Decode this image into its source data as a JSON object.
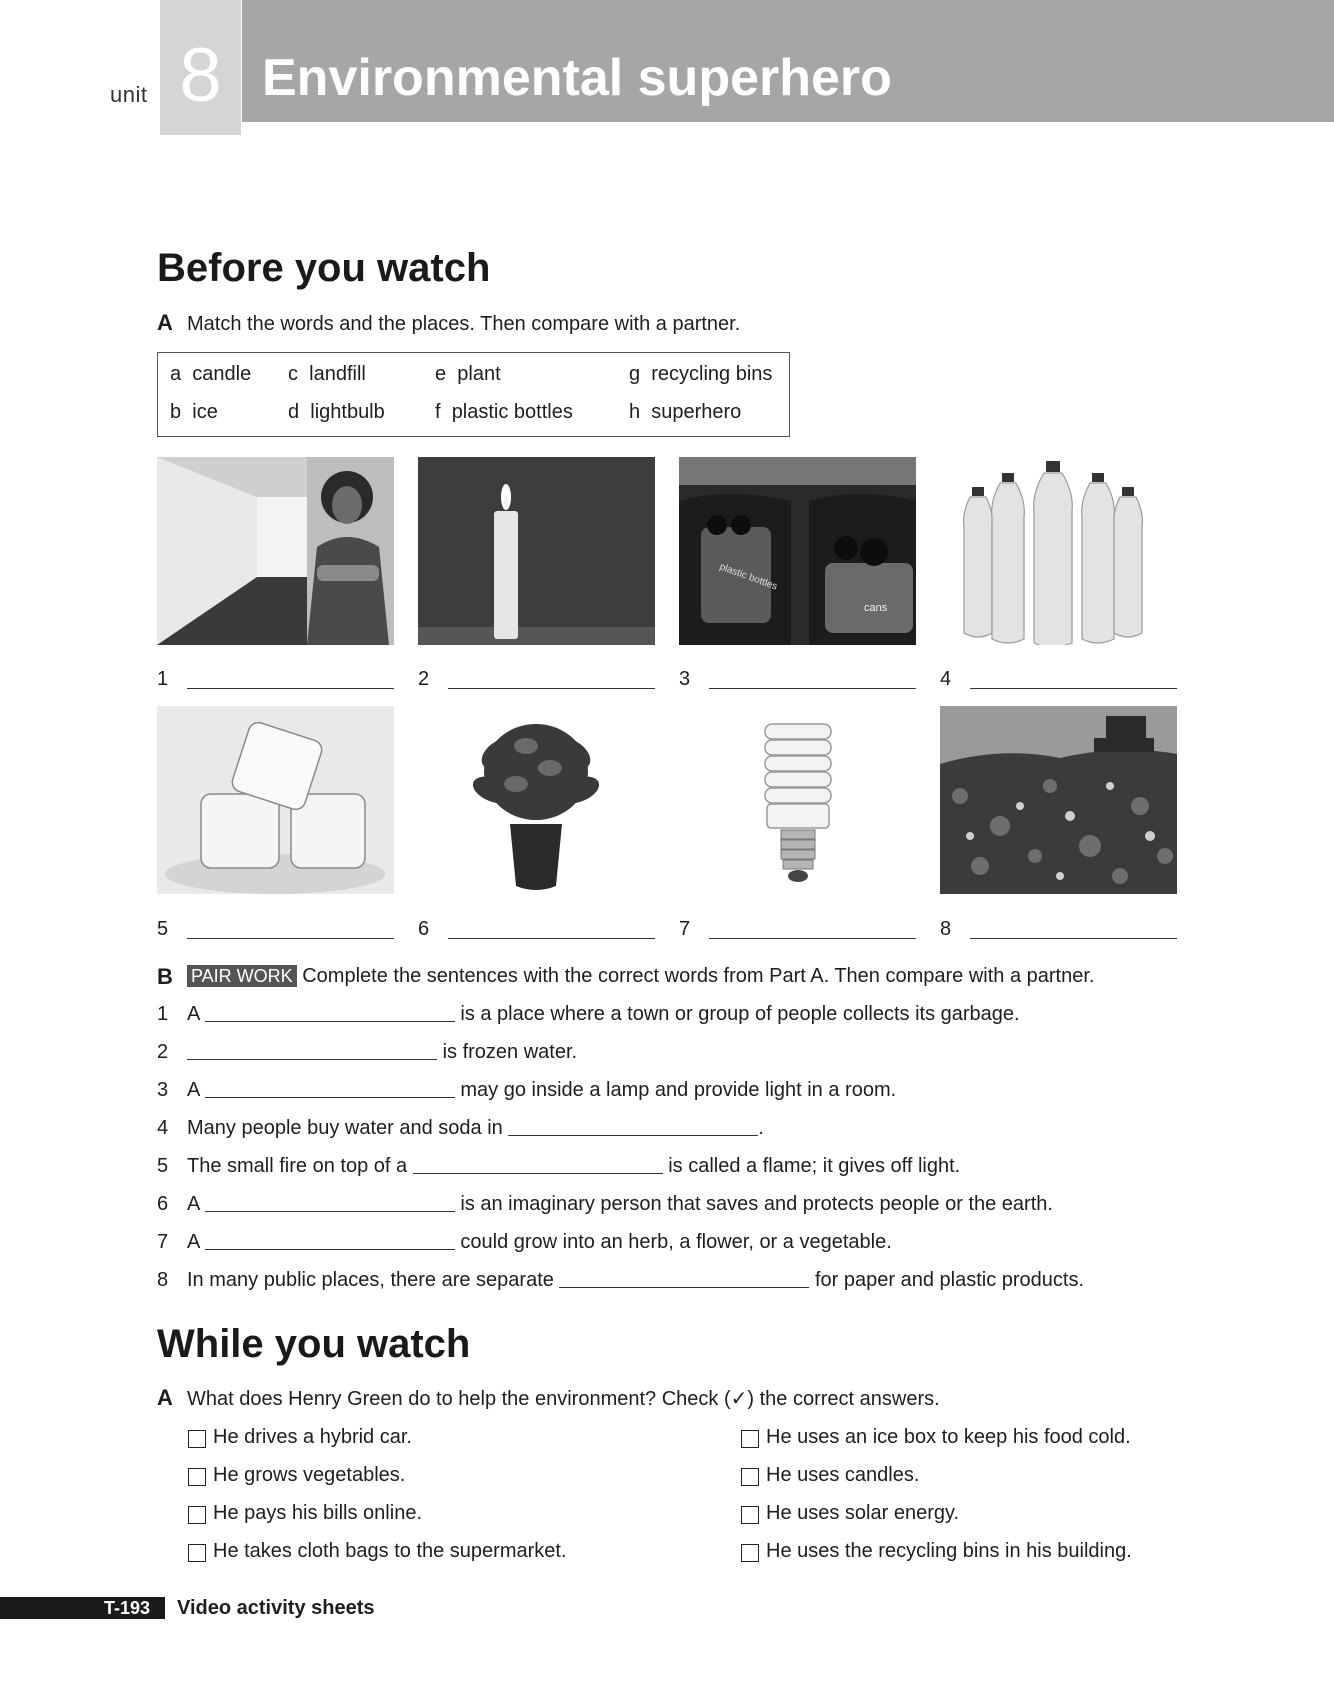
{
  "header": {
    "unit_word": "unit",
    "unit_number": "8",
    "title": "Environmental superhero"
  },
  "before": {
    "heading": "Before you watch",
    "partA": {
      "letter": "A",
      "instruction": "Match the words and the places. Then compare with a partner.",
      "words": [
        {
          "letter": "a",
          "word": "candle"
        },
        {
          "letter": "b",
          "word": "ice"
        },
        {
          "letter": "c",
          "word": "landfill"
        },
        {
          "letter": "d",
          "word": "lightbulb"
        },
        {
          "letter": "e",
          "word": "plant"
        },
        {
          "letter": "f",
          "word": "plastic bottles"
        },
        {
          "letter": "g",
          "word": "recycling bins"
        },
        {
          "letter": "h",
          "word": "superhero"
        }
      ],
      "photo_numbers": [
        "1",
        "2",
        "3",
        "4",
        "5",
        "6",
        "7",
        "8"
      ],
      "photo_text": {
        "bin_label_1": "plastic bottles",
        "bin_label_2": "cans"
      }
    },
    "partB": {
      "letter": "B",
      "badge": "PAIR WORK",
      "instruction": "Complete the sentences with the correct words from Part A. Then compare with a partner.",
      "sentences": [
        {
          "num": "1",
          "before": "A",
          "after": "is a place where a town or group of people collects its garbage."
        },
        {
          "num": "2",
          "before": "",
          "after": "is frozen water."
        },
        {
          "num": "3",
          "before": "A",
          "after": "may go inside a lamp and provide light in a room."
        },
        {
          "num": "4",
          "before": "Many people buy water and soda in",
          "after": "."
        },
        {
          "num": "5",
          "before": "The small fire on top of a",
          "after": "is called a flame; it gives off light."
        },
        {
          "num": "6",
          "before": "A",
          "after": "is an imaginary person that saves and protects people or the earth."
        },
        {
          "num": "7",
          "before": "A",
          "after": "could grow into an herb, a flower, or a vegetable."
        },
        {
          "num": "8",
          "before": "In many public places, there are separate",
          "after": "for paper and plastic products."
        }
      ]
    }
  },
  "while": {
    "heading": "While you watch",
    "partA": {
      "letter": "A",
      "instruction": "What does Henry Green do to help the environment? Check (✓) the correct answers.",
      "left_options": [
        "He drives a hybrid car.",
        "He grows vegetables.",
        "He pays his bills online.",
        "He takes cloth bags to the supermarket."
      ],
      "right_options": [
        "He uses an ice box to keep his food cold.",
        "He uses candles.",
        "He uses solar energy.",
        "He uses the recycling bins in his building."
      ]
    }
  },
  "footer": {
    "code": "T-193",
    "title": "Video activity sheets"
  }
}
